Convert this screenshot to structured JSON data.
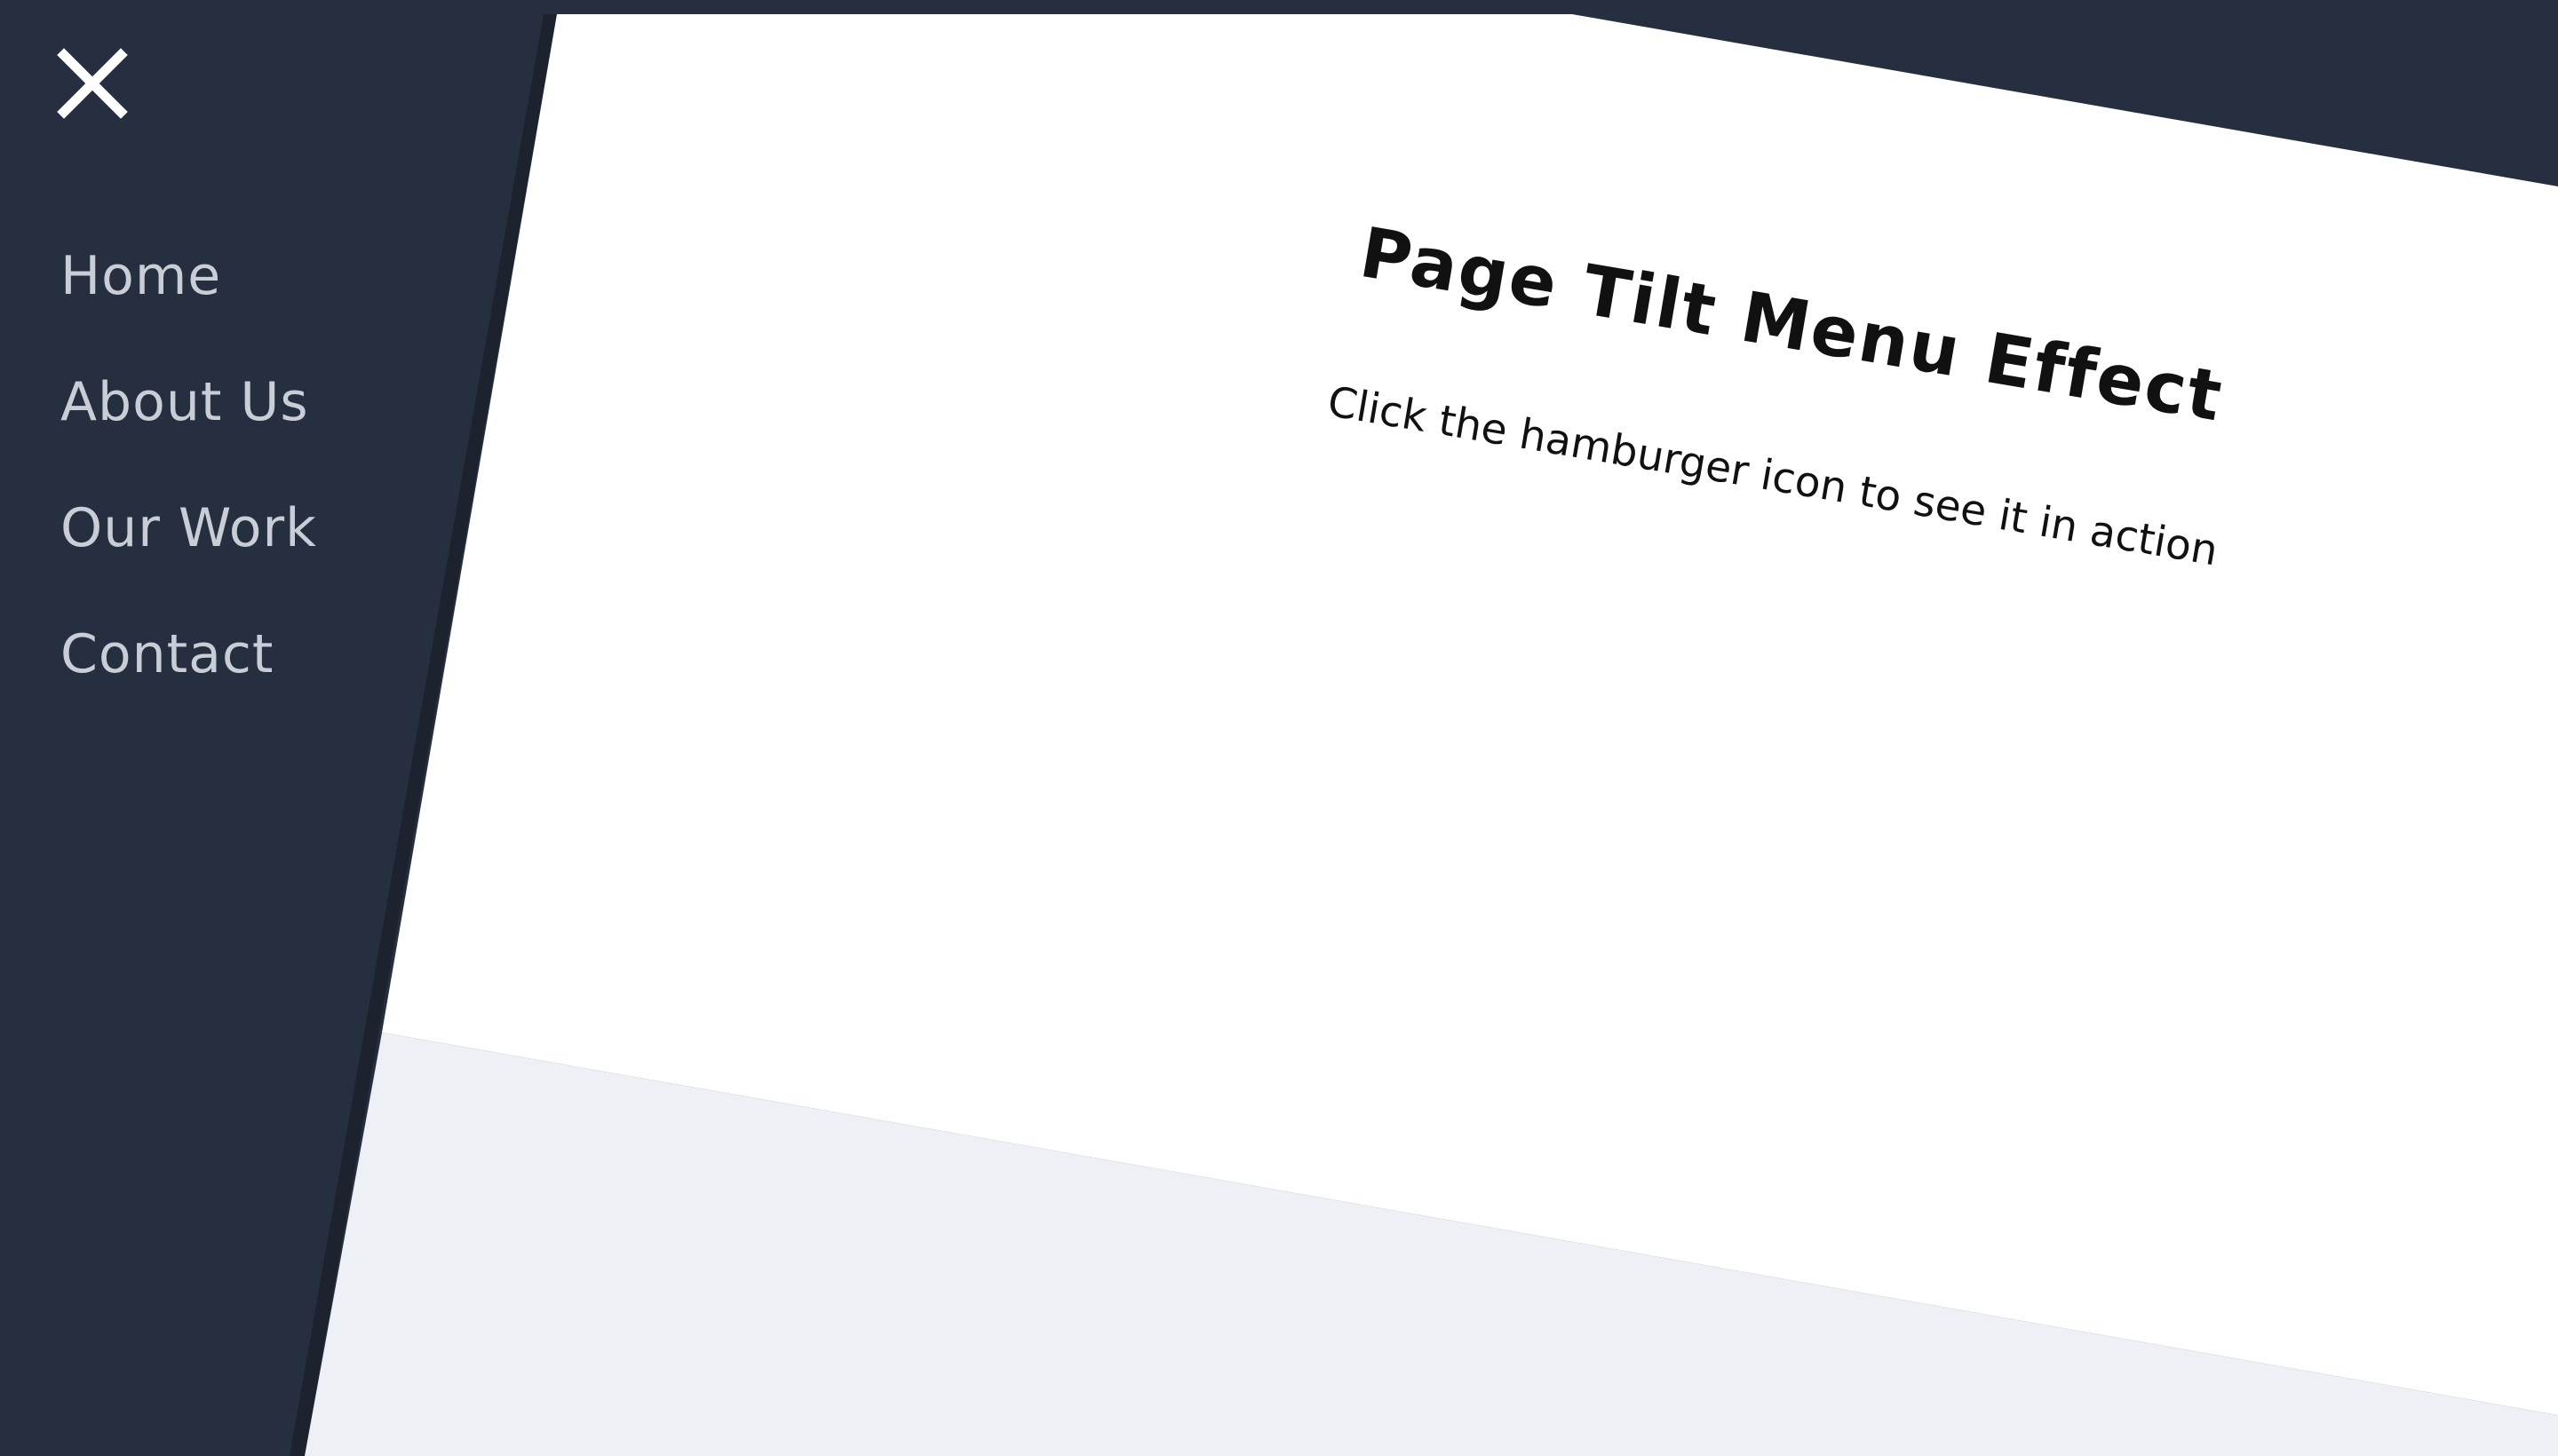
{
  "menu": {
    "close_icon": "close-icon",
    "items": [
      {
        "label": "Home"
      },
      {
        "label": "About Us"
      },
      {
        "label": "Our Work"
      },
      {
        "label": "Contact"
      }
    ]
  },
  "page": {
    "title": "Page Tilt Menu Effect",
    "subtitle": "Click the hamburger icon to see it in action"
  },
  "colors": {
    "menu_background": "#262f3f",
    "menu_text": "#c8cdd6",
    "page_background": "#ffffff",
    "page_lower_background": "#edf0f5",
    "title_text": "#111111"
  }
}
